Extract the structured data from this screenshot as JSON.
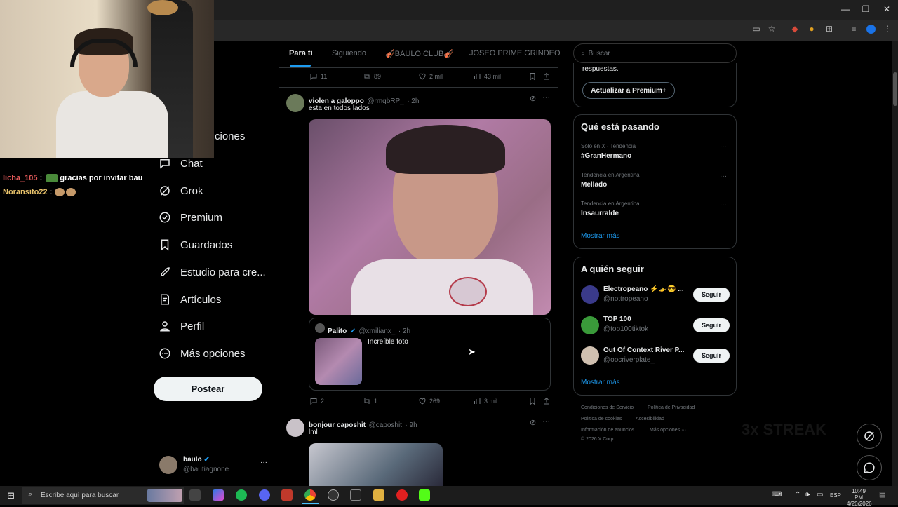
{
  "colors": {
    "accent": "#1d9bf0",
    "bg": "#000000",
    "muted": "#71767b",
    "text": "#e7e9ea"
  },
  "chat": [
    {
      "user": "licha_105",
      "message": "gracias por invitar bau"
    },
    {
      "user": "Noransito22",
      "message": ""
    }
  ],
  "nav": {
    "partial_item": "ciones",
    "items": [
      {
        "label": "Chat",
        "icon": "chat-icon"
      },
      {
        "label": "Grok",
        "icon": "grok-icon"
      },
      {
        "label": "Premium",
        "icon": "premium-icon"
      },
      {
        "label": "Guardados",
        "icon": "bookmark-icon"
      },
      {
        "label": "Estudio para cre...",
        "icon": "rocket-icon"
      },
      {
        "label": "Artículos",
        "icon": "articles-icon"
      },
      {
        "label": "Perfil",
        "icon": "profile-icon"
      },
      {
        "label": "Más opciones",
        "icon": "more-icon"
      }
    ],
    "post_label": "Postear"
  },
  "profile": {
    "name": "baulo",
    "handle": "@bautiagnone"
  },
  "tabs": [
    "Para ti",
    "Siguiendo",
    "🎻BAULO CLUB🎻",
    "JOSEO PRIME GRINDEO"
  ],
  "top_actions": {
    "replies": "11",
    "reposts": "89",
    "likes": "2 mil",
    "views": "43 mil"
  },
  "tweet1": {
    "name": "violen a galoppo",
    "handle": "@rmqbRP_",
    "time": "· 2h",
    "text": "esta en todos lados",
    "quote": {
      "name": "Palito",
      "handle": "@xmilianx_",
      "time": "· 2h",
      "text": "Increíble foto"
    },
    "actions": {
      "replies": "2",
      "reposts": "1",
      "likes": "269",
      "views": "3 mil"
    }
  },
  "tweet2": {
    "name": "bonjour caposhit",
    "handle": "@caposhit",
    "time": "· 9h",
    "text": "lml"
  },
  "search_placeholder": "Buscar",
  "premium": {
    "text": "respuestas.",
    "button": "Actualizar a Premium+"
  },
  "trending": {
    "title": "Qué está pasando",
    "items": [
      {
        "meta": "Solo en X · Tendencia",
        "name": "#GranHermano"
      },
      {
        "meta": "Tendencia en Argentina",
        "name": "Mellado"
      },
      {
        "meta": "Tendencia en Argentina",
        "name": "Insaurralde"
      }
    ],
    "more": "Mostrar más"
  },
  "follow": {
    "title": "A quién seguir",
    "items": [
      {
        "name": "Electropeano ⚡🚁😎 ...",
        "handle": "@nottropeano",
        "button": "Seguir"
      },
      {
        "name": "TOP 100",
        "handle": "@top100tiktok",
        "button": "Seguir"
      },
      {
        "name": "Out Of Context River P...",
        "handle": "@oocriverplate_",
        "button": "Seguir"
      }
    ],
    "more": "Mostrar más"
  },
  "footer": {
    "line1": [
      "Condiciones de Servicio",
      "Política de Privacidad"
    ],
    "line2": [
      "Política de cookies",
      "Accesibilidad"
    ],
    "line3": [
      "Información de anuncios",
      "Más opciones ···"
    ],
    "copyright": "© 2026 X Corp."
  },
  "overlay": {
    "streak": "3x STREAK"
  },
  "taskbar": {
    "search": "Escribe aquí para buscar",
    "lang": "ESP",
    "time": "10:49 PM",
    "date": "4/20/2026"
  }
}
